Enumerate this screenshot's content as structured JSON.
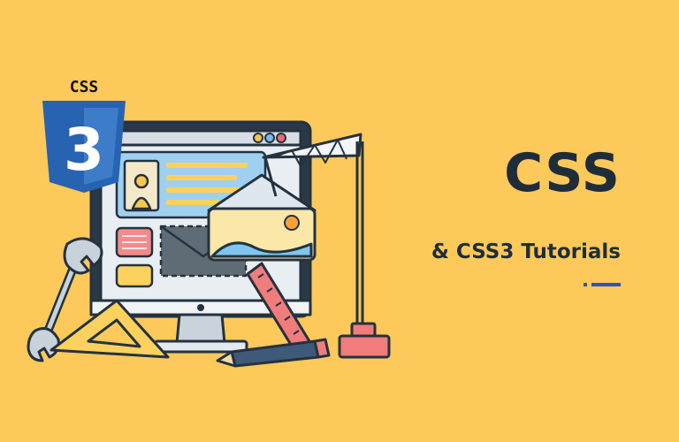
{
  "badge": {
    "label": "CSS",
    "number": "3"
  },
  "hero": {
    "title": "CSS",
    "subtitle": "& CSS3 Tutorials"
  },
  "icons": [
    "css3-logo-icon",
    "monitor-icon",
    "crane-icon",
    "wrench-icon",
    "set-square-icon",
    "ruler-icon",
    "pencil-icon",
    "image-icon",
    "avatar-icon"
  ],
  "colors": {
    "background": "#fcc95a",
    "title": "#1f2d3a",
    "accent": "#2a53c6",
    "css3_blue": "#2763b0",
    "outline": "#243240"
  }
}
